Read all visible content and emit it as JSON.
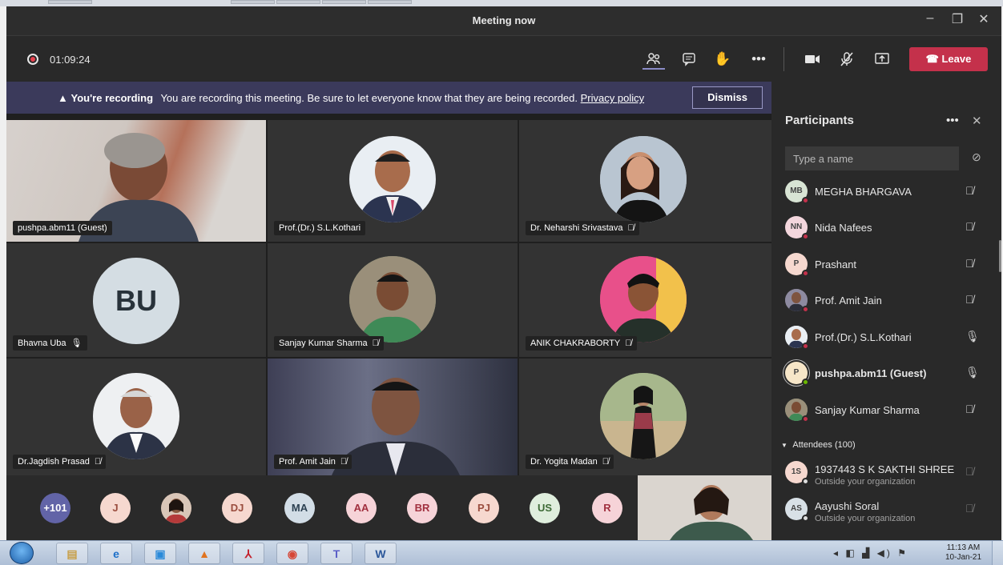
{
  "window": {
    "title": "Meeting now"
  },
  "toolbar": {
    "timer": "01:09:24",
    "leave_label": "Leave",
    "icons": [
      "participants-icon",
      "chat-icon",
      "raise-hand-icon",
      "more-icon",
      "camera-icon",
      "mic-off-icon",
      "share-icon"
    ]
  },
  "banner": {
    "warning": "You're recording",
    "message": "You are recording this meeting. Be sure to let everyone know that they are being recorded.",
    "link": "Privacy policy",
    "dismiss": "Dismiss"
  },
  "tiles": [
    {
      "name": "pushpa.abm11 (Guest)"
    },
    {
      "name": "Prof.(Dr.) S.L.Kothari"
    },
    {
      "name": "Dr. Neharshi Srivastava"
    },
    {
      "name": "Bhavna Uba",
      "initials": "BU"
    },
    {
      "name": "Sanjay Kumar Sharma"
    },
    {
      "name": "ANIK CHAKRABORTY"
    },
    {
      "name": "Dr.Jagdish Prasad"
    },
    {
      "name": "Prof. Amit Jain"
    },
    {
      "name": "Dr. Yogita Madan"
    }
  ],
  "strip": {
    "overflow": "+101",
    "chips": [
      "J",
      "",
      "DJ",
      "MA",
      "AA",
      "BR",
      "PJ",
      "US",
      "R"
    ]
  },
  "panel": {
    "title": "Participants",
    "search_placeholder": "Type a name",
    "participants": [
      {
        "initials": "MB",
        "name": "MEGHA BHARGAVA"
      },
      {
        "initials": "NN",
        "name": "Nida Nafees"
      },
      {
        "initials": "P",
        "name": "Prashant"
      },
      {
        "initials": "",
        "name": "Prof. Amit Jain"
      },
      {
        "initials": "",
        "name": "Prof.(Dr.) S.L.Kothari"
      },
      {
        "initials": "P",
        "name": "pushpa.abm11 (Guest)"
      },
      {
        "initials": "",
        "name": "Sanjay Kumar Sharma"
      }
    ],
    "attendees_label": "Attendees (100)",
    "attendees": [
      {
        "initials": "1S",
        "name": "1937443 S K SAKTHI SHREE",
        "sub": "Outside your organization"
      },
      {
        "initials": "AS",
        "name": "Aayushi Soral",
        "sub": "Outside your organization"
      }
    ]
  },
  "taskbar": {
    "clock_time": "11:13 AM",
    "clock_date": "10-Jan-21"
  }
}
